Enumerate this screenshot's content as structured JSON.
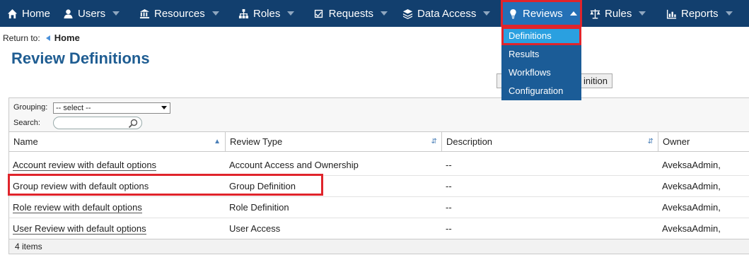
{
  "nav": {
    "items": [
      {
        "label": "Home",
        "icon": "home-icon",
        "has_caret": false
      },
      {
        "label": "Users",
        "icon": "users-icon",
        "has_caret": true
      },
      {
        "label": "Resources",
        "icon": "bank-icon",
        "has_caret": true
      },
      {
        "label": "Roles",
        "icon": "sitemap-icon",
        "has_caret": true
      },
      {
        "label": "Requests",
        "icon": "checkbox-icon",
        "has_caret": true
      },
      {
        "label": "Data Access",
        "icon": "database-icon",
        "has_caret": true
      },
      {
        "label": "Reviews",
        "icon": "lightbulb-icon",
        "has_caret": true,
        "active": true
      },
      {
        "label": "Rules",
        "icon": "balance-scale-icon",
        "has_caret": true
      },
      {
        "label": "Reports",
        "icon": "bar-chart-icon",
        "has_caret": true
      }
    ],
    "colors": {
      "bar": "#123f6e",
      "active": "#2470b6",
      "highlight": "#e0242b"
    }
  },
  "reviews_menu": {
    "items": [
      "Definitions",
      "Results",
      "Workflows",
      "Configuration"
    ],
    "selected": "Definitions"
  },
  "breadcrumb": {
    "prefix": "Return to:",
    "home": "Home"
  },
  "page": {
    "title": "Review Definitions",
    "action_button_visible_text": "inition"
  },
  "filters": {
    "grouping_label": "Grouping:",
    "grouping_value": "-- select --",
    "search_label": "Search:",
    "search_value": ""
  },
  "table": {
    "columns": [
      "Name",
      "Review Type",
      "Description",
      "Owner"
    ],
    "rows": [
      {
        "name": "Account review with default options",
        "type": "Account Access and Ownership",
        "description": "--",
        "owner": "AveksaAdmin,"
      },
      {
        "name": "Group review with default options",
        "type": "Group Definition",
        "description": "--",
        "owner": "AveksaAdmin,"
      },
      {
        "name": "Role review with default options",
        "type": "Role Definition",
        "description": "--",
        "owner": "AveksaAdmin,"
      },
      {
        "name": "User Review with default options",
        "type": "User Access",
        "description": "--",
        "owner": "AveksaAdmin,"
      }
    ],
    "footer": "4 items"
  }
}
